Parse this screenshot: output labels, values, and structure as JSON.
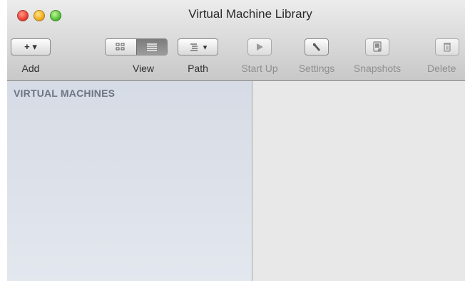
{
  "window": {
    "title": "Virtual Machine Library"
  },
  "toolbar": {
    "add_label": "Add",
    "view_label": "View",
    "path_label": "Path",
    "startup_label": "Start Up",
    "settings_label": "Settings",
    "snapshots_label": "Snapshots",
    "delete_label": "Delete",
    "add_glyph": "+ ▾",
    "path_glyph": "▾"
  },
  "sidebar": {
    "header": "VIRTUAL MACHINES"
  },
  "icons": {
    "close": "close-icon",
    "minimize": "minimize-icon",
    "zoom": "zoom-icon",
    "grid_view": "grid-view-icon",
    "list_view": "list-view-icon",
    "path": "path-icon",
    "play": "play-icon",
    "wrench": "wrench-icon",
    "snapshot": "snapshot-icon",
    "trash": "trash-icon"
  },
  "colors": {
    "sidebar_bg": "#dde1ea",
    "sidebar_header": "#6c7684",
    "content_bg": "#e8e8e8",
    "close": "#f0483b",
    "minimize": "#f4b326",
    "zoom": "#5ec940"
  }
}
